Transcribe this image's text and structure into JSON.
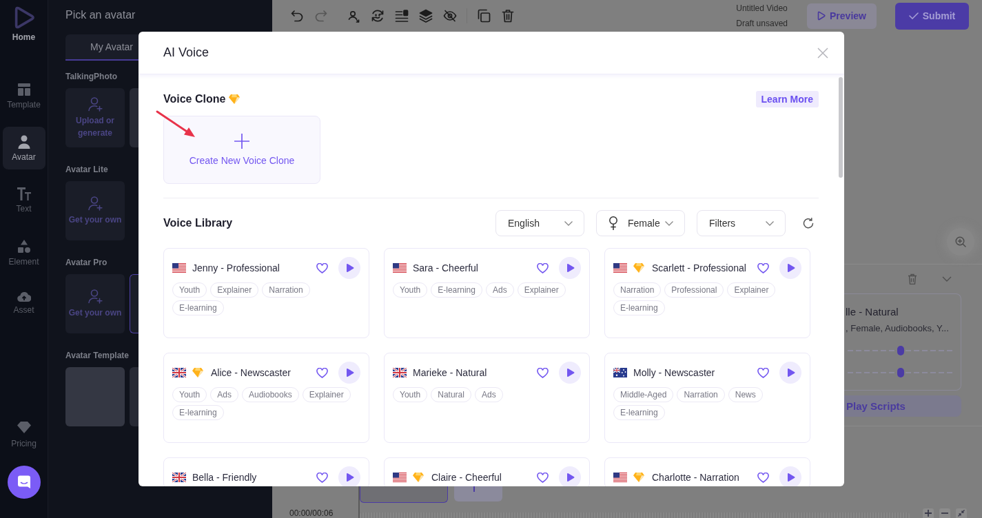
{
  "sidebar": {
    "home": {
      "label": "Home"
    },
    "items": [
      {
        "label": "Template",
        "selected": false
      },
      {
        "label": "Avatar",
        "selected": true
      },
      {
        "label": "Text",
        "selected": false
      },
      {
        "label": "Element",
        "selected": false
      },
      {
        "label": "Asset",
        "selected": false
      }
    ],
    "pricing": {
      "label": "Pricing"
    }
  },
  "avatar_panel": {
    "title": "Pick an avatar",
    "tabs": [
      {
        "label": "My Avatar",
        "selected": true
      }
    ],
    "sections": [
      {
        "title": "TalkingPhoto",
        "cards": [
          {
            "kind": "add",
            "label": "Upload or generate",
            "selected": false
          },
          {
            "kind": "photo",
            "selected": false
          }
        ]
      },
      {
        "title": "Avatar Lite",
        "cards": [
          {
            "kind": "add",
            "label": "Get your own",
            "selected": false
          }
        ]
      },
      {
        "title": "Avatar Pro",
        "cards": [
          {
            "kind": "add",
            "label": "Get your own",
            "selected": false
          },
          {
            "kind": "photo",
            "selected": true
          }
        ]
      },
      {
        "title": "Avatar Template",
        "cards": [
          {
            "kind": "photo",
            "selected": false
          },
          {
            "kind": "photo",
            "selected": false
          }
        ]
      }
    ]
  },
  "toolbar": {
    "tools": [
      {
        "disabled": false
      },
      {
        "disabled": true
      },
      {
        "disabled": false
      },
      {
        "disabled": false
      },
      {
        "disabled": false
      },
      {
        "disabled": false
      },
      {
        "disabled": false
      },
      {
        "disabled": false
      },
      {
        "disabled": false
      }
    ],
    "project_title": "Untitled Video",
    "save_status": "Draft unsaved",
    "buttons": [
      {
        "kind": "preview",
        "label": "Preview"
      },
      {
        "kind": "submit",
        "label": "Submit"
      }
    ]
  },
  "voice_panel": {
    "voice_name": "lle - Natural",
    "voice_tags": ", Female, Audiobooks, Y...",
    "sliders": [
      {
        "level": 0.5
      },
      {
        "level": 0.5
      }
    ],
    "play_button": "Play Scripts"
  },
  "timeline": {
    "time": "00:00/00:06"
  },
  "modal": {
    "title": "AI Voice",
    "voice_clone": {
      "title": "Voice Clone",
      "premium": true,
      "learn_more": "Learn More",
      "create_label": "Create New Voice Clone"
    },
    "voice_library": {
      "title": "Voice Library",
      "filters": [
        {
          "kind": "language",
          "label": "English"
        },
        {
          "kind": "gender",
          "label": "Female"
        },
        {
          "kind": "filters",
          "label": "Filters"
        }
      ],
      "voices": [
        {
          "name": "Jenny - Professional",
          "kind": "us",
          "premium": false,
          "tags": [
            "Youth",
            "Explainer",
            "Narration",
            "E-learning"
          ]
        },
        {
          "name": "Sara - Cheerful",
          "kind": "us",
          "premium": false,
          "tags": [
            "Youth",
            "E-learning",
            "Ads",
            "Explainer"
          ]
        },
        {
          "name": "Scarlett - Professional",
          "kind": "us",
          "premium": true,
          "tags": [
            "Narration",
            "Professional",
            "Explainer",
            "E-learning"
          ]
        },
        {
          "name": "Alice - Newscaster",
          "kind": "uk",
          "premium": true,
          "tags": [
            "Youth",
            "Ads",
            "Audiobooks",
            "Explainer",
            "E-learning"
          ]
        },
        {
          "name": "Marieke - Natural",
          "kind": "uk",
          "premium": false,
          "tags": [
            "Youth",
            "Natural",
            "Ads"
          ]
        },
        {
          "name": "Molly - Newscaster",
          "kind": "australia",
          "premium": false,
          "tags": [
            "Middle-Aged",
            "Narration",
            "News",
            "E-learning"
          ]
        },
        {
          "name": "Bella - Friendly",
          "kind": "uk",
          "premium": false
        },
        {
          "name": "Claire - Cheerful",
          "kind": "us",
          "premium": true
        },
        {
          "name": "Charlotte - Narration",
          "kind": "us",
          "premium": true
        }
      ]
    }
  }
}
